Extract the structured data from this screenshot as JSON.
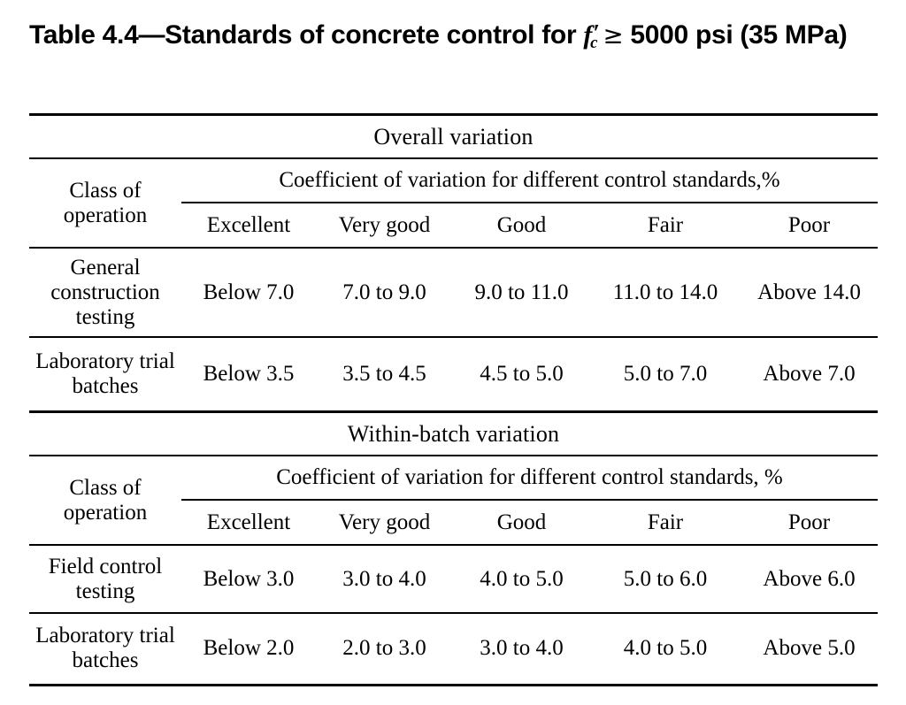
{
  "title": {
    "prefix": "Table 4.4—Standards of concrete control for ",
    "symbol": "f",
    "symbol_subscript": "c",
    "symbol_prime": "′",
    "comparator": "≥",
    "suffix": "5000 psi (35 MPa)",
    "full_text": "Table 4.4—Standards of concrete control for fc′ ≥ 5000 psi (35 MPa)"
  },
  "tables": [
    {
      "id": "overall",
      "section_heading": "Overall variation",
      "row_header_label": "Class of operation",
      "span_header": "Coefficient of variation for different control standards,%",
      "grade_headers": [
        "Excellent",
        "Very good",
        "Good",
        "Fair",
        "Poor"
      ],
      "rows": [
        {
          "label": "General construction testing",
          "values": [
            "Below 7.0",
            "7.0 to 9.0",
            "9.0 to 11.0",
            "11.0 to 14.0",
            "Above 14.0"
          ]
        },
        {
          "label": "Laboratory trial batches",
          "values": [
            "Below 3.5",
            "3.5 to 4.5",
            "4.5 to 5.0",
            "5.0 to 7.0",
            "Above 7.0"
          ]
        }
      ]
    },
    {
      "id": "within",
      "section_heading": "Within-batch variation",
      "row_header_label": "Class of operation",
      "span_header": "Coefficient of variation for different control standards, %",
      "grade_headers": [
        "Excellent",
        "Very good",
        "Good",
        "Fair",
        "Poor"
      ],
      "rows": [
        {
          "label": "Field control testing",
          "values": [
            "Below 3.0",
            "3.0 to 4.0",
            "4.0 to 5.0",
            "5.0 to 6.0",
            "Above 6.0"
          ]
        },
        {
          "label": "Laboratory trial batches",
          "values": [
            "Below 2.0",
            "2.0 to 3.0",
            "3.0 to 4.0",
            "4.0 to 5.0",
            "Above 5.0"
          ]
        }
      ]
    }
  ],
  "colors": {
    "text": "#000000",
    "background": "#ffffff",
    "rule": "#000000"
  }
}
